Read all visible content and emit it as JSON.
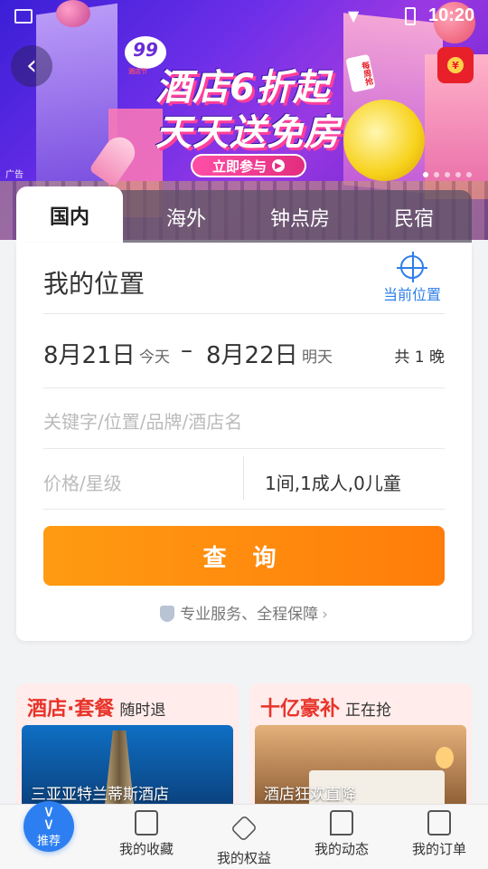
{
  "status_bar": {
    "time": "10:20"
  },
  "banner": {
    "badge": "99",
    "badge_sub": "酒店节",
    "headline_1": "酒店6折起",
    "headline_2": "天天送免房",
    "tag": "每周抢",
    "cta": "立即参与",
    "ad_label": "广告"
  },
  "tabs": [
    "国内",
    "海外",
    "钟点房",
    "民宿"
  ],
  "search": {
    "location": "我的位置",
    "current_location": "当前位置",
    "checkin_date": "8月21日",
    "checkin_label": "今天",
    "dash": "–",
    "checkout_date": "8月22日",
    "checkout_label": "明天",
    "nights": "共 1 晚",
    "keyword_placeholder": "关键字/位置/品牌/酒店名",
    "price_placeholder": "价格/星级",
    "guests": "1间,1成人,0儿童",
    "search_button": "查 询",
    "guarantee": "专业服务、全程保障"
  },
  "promos": [
    {
      "title": "酒店·套餐",
      "subtitle": "随时退",
      "caption": "三亚亚特兰蒂斯酒店"
    },
    {
      "title": "十亿豪补",
      "subtitle": "正在抢",
      "caption": "酒店狂欢直降"
    }
  ],
  "bottom_nav": {
    "recommend": "推荐",
    "items": [
      "我的收藏",
      "我的权益",
      "我的动态",
      "我的订单"
    ]
  },
  "colors": {
    "accent_blue": "#2f7fe8",
    "search_orange": "#ff8d0e",
    "promo_red": "#e8342a"
  }
}
